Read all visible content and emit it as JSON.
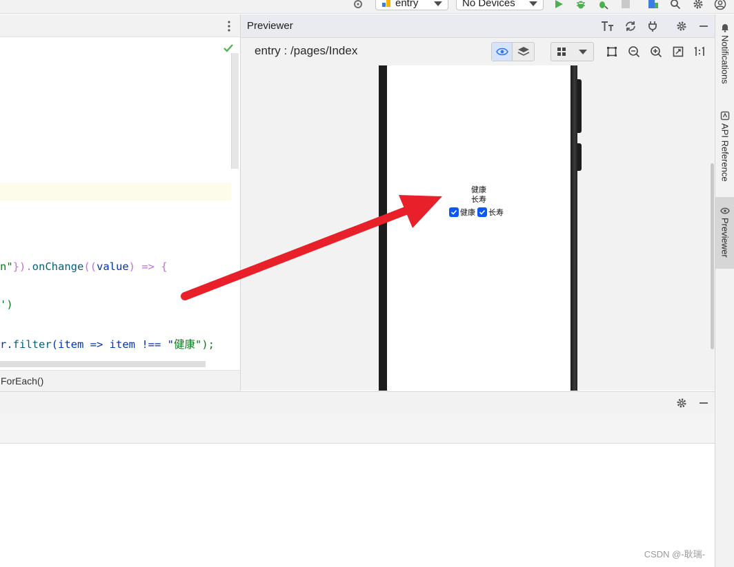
{
  "toolbar": {
    "module_select": "entry",
    "device_select": "No Devices"
  },
  "editor": {
    "code_lines": {
      "l1_a": "n\"",
      "l1_b": "}).",
      "l1_c": "onChange",
      "l1_d": "((",
      "l1_e": "value",
      "l1_f": ") => {",
      "l2": "')",
      "l3_a": "r.",
      "l3_b": "filter",
      "l3_c": "(item => item !== \"",
      "l3_d": "健康",
      "l3_e": "\");"
    },
    "breadcrumb": "ForEach()"
  },
  "previewer": {
    "title": "Previewer",
    "page_path": "entry : /pages/Index",
    "device_screen": {
      "line1": "健康",
      "line2": "长寿",
      "checkbox1_label": "健康",
      "checkbox2_label": "长寿"
    }
  },
  "side_tabs": {
    "notifications": "Notifications",
    "api_reference": "API Reference",
    "previewer": "Previewer"
  },
  "watermark": "CSDN @-耿瑞-",
  "colors": {
    "accent_blue": "#0a59f7",
    "arrow_red": "#e8202a",
    "run_green": "#4caf50"
  }
}
